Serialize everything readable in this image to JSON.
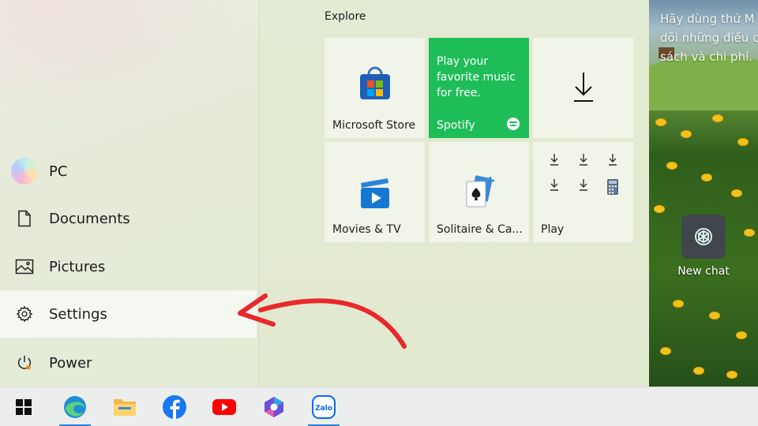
{
  "wallpaper": {
    "text_lines": [
      "Hãy dùng thử M",
      "dõi những điều c",
      "sách và chi phí."
    ],
    "shortcut": {
      "label": "New chat",
      "icon": "chatgpt-icon"
    }
  },
  "start_menu": {
    "nav": [
      {
        "label": "PC",
        "icon": "avatar"
      },
      {
        "label": "Documents",
        "icon": "document-icon"
      },
      {
        "label": "Pictures",
        "icon": "pictures-icon"
      },
      {
        "label": "Settings",
        "icon": "gear-icon",
        "highlighted": true
      },
      {
        "label": "Power",
        "icon": "power-icon"
      }
    ],
    "section_title": "Explore",
    "tiles": [
      {
        "label": "Microsoft Store",
        "icon": "store-icon"
      },
      {
        "label": "Spotify",
        "promo": "Play your favorite music for free.",
        "color": "#1ebd58",
        "icon": "spotify-icon"
      },
      {
        "label": "",
        "icon": "download-icon"
      },
      {
        "label": "Movies & TV",
        "icon": "movies-tv-icon"
      },
      {
        "label": "Solitaire & Ca...",
        "icon": "solitaire-icon"
      },
      {
        "label": "Play",
        "icon": "download-icon"
      }
    ]
  },
  "taskbar": {
    "items": [
      {
        "icon": "windows-start-icon",
        "active": false
      },
      {
        "icon": "edge-icon",
        "active": true
      },
      {
        "icon": "file-explorer-icon",
        "active": false
      },
      {
        "icon": "facebook-icon",
        "active": false
      },
      {
        "icon": "youtube-icon",
        "active": false
      },
      {
        "icon": "copilot-icon",
        "active": false
      },
      {
        "icon": "zalo-icon",
        "active": true
      }
    ],
    "zalo_text": "Zalo"
  },
  "colors": {
    "accent": "#2e7fd8",
    "spotify": "#1ebd58",
    "annotation_arrow": "#e8282b"
  }
}
